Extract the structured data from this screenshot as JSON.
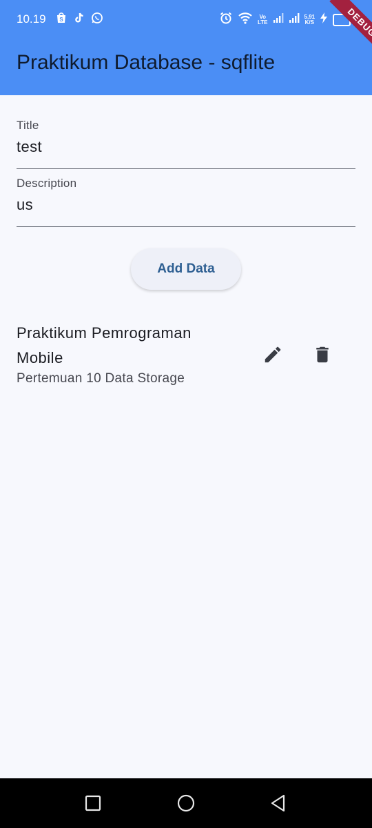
{
  "status_bar": {
    "time": "10.19",
    "left_icons": [
      "shopee-icon",
      "tiktok-icon",
      "whatsapp-icon"
    ],
    "volte_top": "Vo",
    "volte_bottom": "LTE",
    "speed_value": "5,91",
    "speed_unit": "K/S"
  },
  "debug_banner": "DEBUG",
  "app_bar": {
    "title": "Praktikum Database - sqflite"
  },
  "form": {
    "title_label": "Title",
    "title_value": "test",
    "description_label": "Description",
    "description_value": "us",
    "add_button_label": "Add Data"
  },
  "items": [
    {
      "title": "Praktikum Pemrograman Mobile",
      "subtitle": "Pertemuan 10 Data Storage"
    }
  ],
  "colors": {
    "app_bar": "#4b8ef5",
    "background": "#f7f8fd",
    "button_text": "#2e5f92",
    "debug_banner": "#a3213f"
  }
}
